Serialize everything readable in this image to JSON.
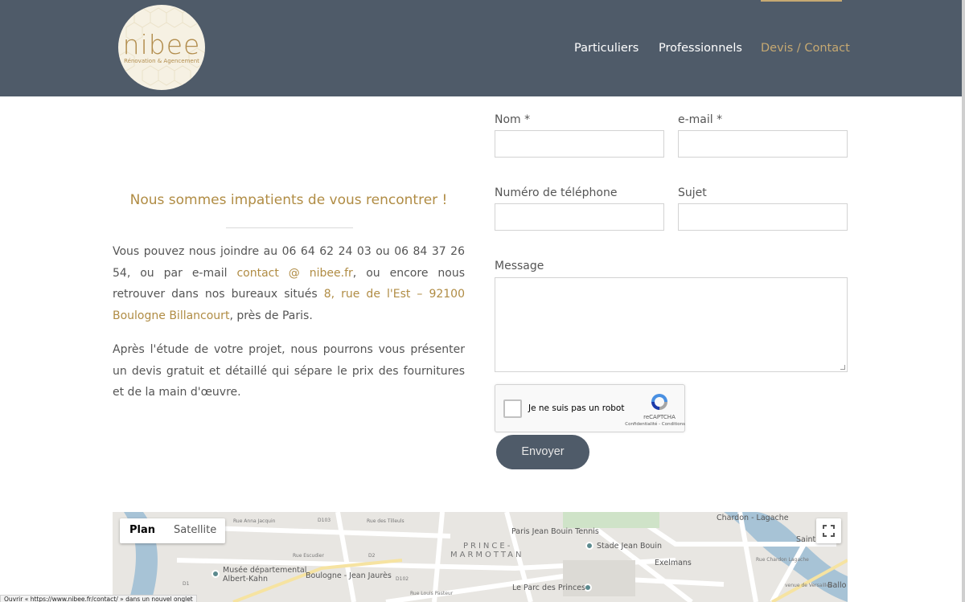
{
  "header": {
    "logo_word": "nibee",
    "logo_sub": "Rénovation & Agencement",
    "nav": [
      {
        "label": "Particuliers",
        "active": false
      },
      {
        "label": "Professionnels",
        "active": false
      },
      {
        "label": "Devis / Contact",
        "active": true
      }
    ]
  },
  "intro": {
    "tagline": "Nous sommes impatients de vous rencontrer !",
    "p1_a": "Vous pouvez nous joindre au 06 64 62 24 03 ou 06 84 37 26 54, ou par e-mail ",
    "p1_email": "contact @ nibee.fr",
    "p1_b": ", ou encore nous retrouver dans nos bureaux situés ",
    "p1_address": "8, rue de l'Est – 92100 Boulogne Billancourt",
    "p1_c": ", près de Paris.",
    "p2": "Après l'étude de votre projet, nous pourrons vous présenter un devis gratuit et détaillé qui sépare le prix des fournitures et de la main d'œuvre."
  },
  "form": {
    "nom_label": "Nom *",
    "email_label": "e-mail *",
    "phone_label": "Numéro de téléphone",
    "subject_label": "Sujet",
    "message_label": "Message",
    "nom_value": "",
    "email_value": "",
    "phone_value": "",
    "subject_value": "",
    "message_value": "",
    "recaptcha_text": "Je ne suis pas un robot",
    "recaptcha_brand": "reCAPTCHA",
    "recaptcha_links": "Confidentialité - Conditions",
    "submit_label": "Envoyer"
  },
  "map": {
    "plan_label": "Plan",
    "satellite_label": "Satellite",
    "labels": {
      "chardon": "Chardon - Lagache",
      "jean_bouin_tennis": "Paris Jean Bouin Tennis",
      "stade_jean_bouin": "Stade Jean Bouin",
      "exelmans": "Exelmans",
      "prince_marmottan_1": "PRINCE-",
      "prince_marmottan_2": "MARMOTTAN",
      "musee_1": "Musée départemental",
      "musee_2": "Albert-Kahn",
      "boulogne_jaures": "Boulogne - Jean Jaurès",
      "parc_princes": "Le Parc des Princes",
      "saint": "Saint",
      "ballon": "Ballo",
      "rue_escudier": "Rue Escudier",
      "rue_anna_jacquin": "Rue Anna Jacquin",
      "rue_des_tilleuls": "Rue des Tilleuls",
      "rue_louis_pasteur": "Rue Louis Pasteur",
      "avenue_versailles": "venue de Versailles",
      "rue_chardon_lagache": "Rue Chardon Lagache",
      "d103": "D103",
      "d2": "D2",
      "d102": "D102",
      "d1": "D1"
    },
    "colors": {
      "water": "#a7c3d6",
      "road": "#ffffff",
      "land": "#e8e6e2",
      "park": "#cfe3c8"
    }
  },
  "status_bar": "Ouvrir « https://www.nibee.fr/contact/ » dans un nouvel onglet",
  "colors": {
    "header_bg": "#4f5b69",
    "accent_gold": "#b08c44",
    "nav_active": "#c6a972"
  }
}
